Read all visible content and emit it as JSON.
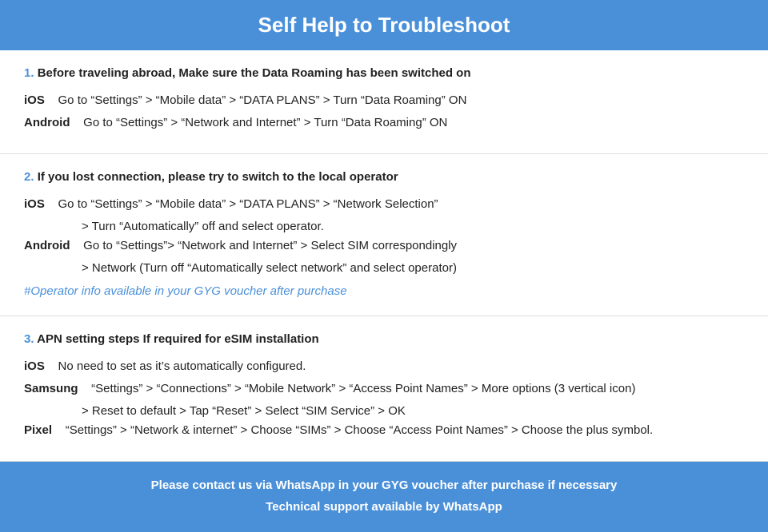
{
  "header": {
    "title": "Self Help to Troubleshoot"
  },
  "sections": [
    {
      "id": "section-1",
      "number": "1.",
      "title": "Before traveling abroad, Make sure the Data Roaming has been switched on",
      "items": [
        {
          "platform": "iOS",
          "instruction": "Go to “Settings” > “Mobile data” > “DATA PLANS” > Turn “Data Roaming” ON",
          "continuation": null
        },
        {
          "platform": "Android",
          "instruction": "Go to “Settings” > “Network and Internet” > Turn “Data Roaming” ON",
          "continuation": null
        }
      ],
      "note": null
    },
    {
      "id": "section-2",
      "number": "2.",
      "title": "If you lost connection, please try to switch to the local operator",
      "items": [
        {
          "platform": "iOS",
          "instruction": "Go to “Settings” > “Mobile data” > “DATA PLANS” > “Network Selection”",
          "continuation": "> Turn “Automatically” off and select operator."
        },
        {
          "platform": "Android",
          "instruction": "Go to “Settings”>  “Network and Internet” > Select SIM correspondingly",
          "continuation": "> Network (Turn off “Automatically select network” and select operator)"
        }
      ],
      "note": "#Operator info available in your GYG voucher after purchase"
    },
    {
      "id": "section-3",
      "number": "3.",
      "title": "APN setting steps If required for eSIM installation",
      "items": [
        {
          "platform": "iOS",
          "instruction": "No need to set as it’s automatically configured.",
          "continuation": null
        },
        {
          "platform": "Samsung",
          "instruction": "“Settings” > “Connections” > “Mobile Network” > “Access Point Names” > More options (3 vertical icon)",
          "continuation": "> Reset to default > Tap “Reset” > Select “SIM Service” > OK"
        },
        {
          "platform": "Pixel",
          "instruction": "“Settings” > “Network & internet” > Choose “SIMs” > Choose “Access Point Names” > Choose the plus symbol.",
          "continuation": null
        }
      ],
      "note": null
    }
  ],
  "footer": {
    "line1": "Please contact us via WhatsApp  in your GYG voucher after purchase if necessary",
    "line2": "Technical support available by WhatsApp"
  }
}
